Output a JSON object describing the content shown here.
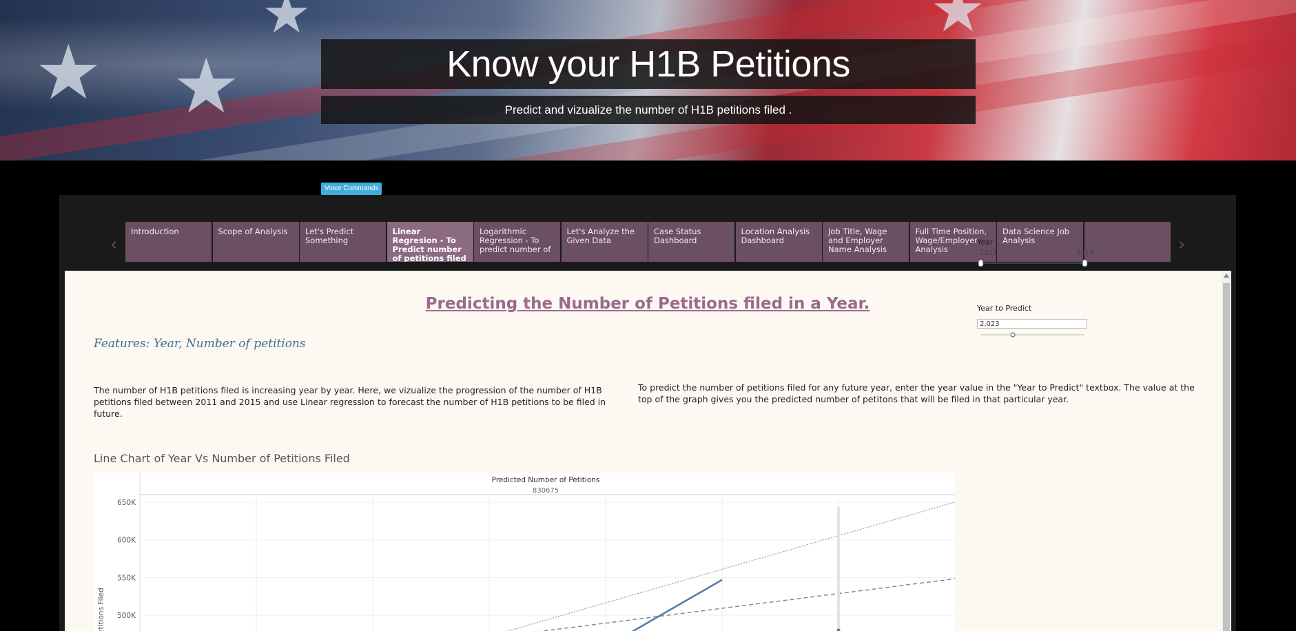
{
  "banner": {
    "title": "Know your H1B Petitions",
    "subtitle": "Predict and vizualize the number of H1B petitions filed ."
  },
  "voice_button": "Voice Commands",
  "tabs": [
    {
      "label": "Introduction",
      "active": false
    },
    {
      "label": "Scope of Analysis",
      "active": false
    },
    {
      "label": "Let's Predict Something",
      "active": false
    },
    {
      "label": "Linear Regresion - To Predict number of petitions filed for",
      "active": true
    },
    {
      "label": "Logarithmic Regression - To predict number of",
      "active": false
    },
    {
      "label": "Let's Analyze the Given Data",
      "active": false
    },
    {
      "label": "Case Status Dashboard",
      "active": false
    },
    {
      "label": "Location Analysis Dashboard",
      "active": false
    },
    {
      "label": "Job Title, Wage and Employer Name Analysis",
      "active": false
    },
    {
      "label": "Full Time Position, Wage/Employer Analysis",
      "active": false
    },
    {
      "label": "Data Science Job Analysis",
      "active": false
    },
    {
      "label": "",
      "active": false
    }
  ],
  "content": {
    "heading": "Predicting the Number of Petitions filed in a Year.",
    "features": "Features: Year, Number of petitions",
    "para_left": "The number of H1B petitions filed is increasing year by year. Here, we vizualize the progression of the number of H1B petitions filed between 2011 and 2015 and use Linear regression to forecast the number of H1B petitions to be filed in future.",
    "para_right": "To predict the number of petitions filed for any future year, enter the year value in the \"Year to Predict\" textbox. The value at the top of the graph gives you the predicted number of petitons that will be filed in that particular year.",
    "chart_title": "Line Chart of Year Vs Number of Petitions Filed"
  },
  "chart_data": {
    "type": "line",
    "header_label": "Predicted Number of Petitions",
    "header_value": "830675",
    "ylabel": "Petitions Filed",
    "yticks": [
      "650K",
      "600K",
      "550K",
      "500K"
    ],
    "ytick_values": [
      650000,
      600000,
      550000,
      500000
    ],
    "ylim": [
      470000,
      660000
    ],
    "xlim": [
      2010,
      2017
    ],
    "series": [
      {
        "values": [
          [
            2014,
            458000
          ],
          [
            2015,
            547000
          ]
        ]
      }
    ],
    "trend_lower": [
      [
        2013,
        470000
      ],
      [
        2018,
        568000
      ]
    ],
    "trend_upper": [
      [
        2013,
        472000
      ],
      [
        2017,
        650000
      ]
    ],
    "prediction_point": {
      "x": 2016,
      "y": 480000
    },
    "color_series": "#4e79a7",
    "color_trend": "#888888"
  },
  "controls": {
    "year_label": "Year",
    "year_min": "2011",
    "year_max": "2016",
    "year_to_predict_label": "Year to Predict",
    "year_to_predict_value": "2,023"
  },
  "colors": {
    "tab_bg": "#6b4f62",
    "tab_active_bg": "#8c6a82",
    "content_bg": "#fdf8f1",
    "heading": "#9a6a8d",
    "features": "#3f6f9a",
    "voice_button": "#42aedb"
  }
}
